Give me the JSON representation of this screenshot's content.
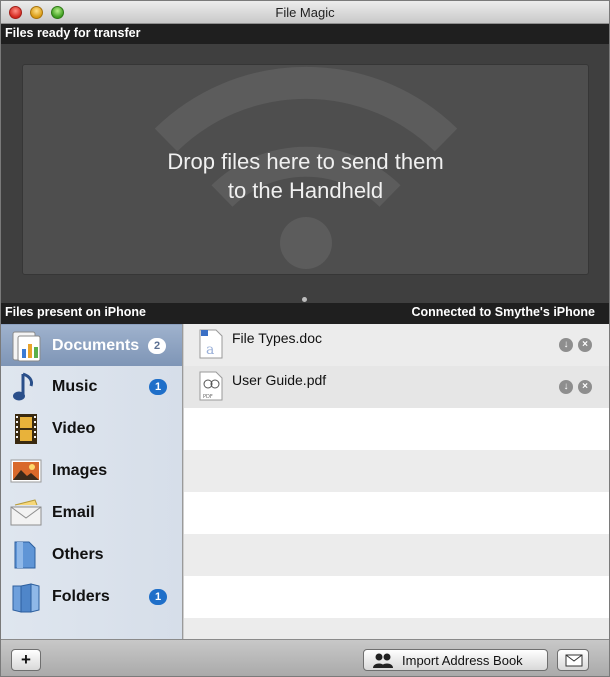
{
  "window": {
    "title": "File Magic"
  },
  "transfer": {
    "header": "Files ready for transfer",
    "drop_line1": "Drop files here to send them",
    "drop_line2": "to the Handheld"
  },
  "device": {
    "header_left": "Files present on iPhone",
    "header_right": "Connected to Smythe's iPhone"
  },
  "sidebar": {
    "items": [
      {
        "label": "Documents",
        "badge": "2",
        "selected": true,
        "icon": "documents-icon"
      },
      {
        "label": "Music",
        "badge": "1",
        "selected": false,
        "icon": "music-note-icon"
      },
      {
        "label": "Video",
        "badge": "",
        "selected": false,
        "icon": "film-strip-icon"
      },
      {
        "label": "Images",
        "badge": "",
        "selected": false,
        "icon": "image-icon"
      },
      {
        "label": "Email",
        "badge": "",
        "selected": false,
        "icon": "envelope-icon"
      },
      {
        "label": "Others",
        "badge": "",
        "selected": false,
        "icon": "others-icon"
      },
      {
        "label": "Folders",
        "badge": "1",
        "selected": false,
        "icon": "folders-icon"
      }
    ]
  },
  "files": [
    {
      "name": "File Types.doc",
      "icon": "doc-file-icon"
    },
    {
      "name": "User Guide.pdf",
      "icon": "pdf-file-icon"
    }
  ],
  "toolbar": {
    "add_label": "+",
    "import_label": "Import Address Book",
    "mail_icon": "mail-icon"
  },
  "colors": {
    "selected_row": "#8ca0bf",
    "badge_blue": "#1f6fc9",
    "header_bar": "#1f1f1f"
  }
}
